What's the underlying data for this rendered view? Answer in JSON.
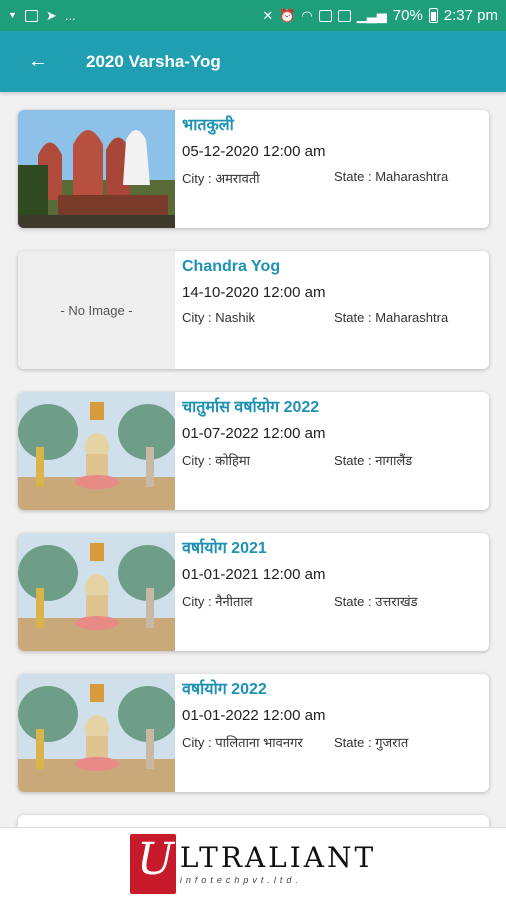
{
  "status_bar": {
    "left_icons": [
      "kb-icon",
      "image-icon",
      "telegram-icon",
      "more-icon"
    ],
    "more_text": "...",
    "battery": "70%",
    "time": "2:37 pm"
  },
  "app_bar": {
    "back_icon": "←",
    "title": "2020 Varsha-Yog"
  },
  "cards": [
    {
      "title": "भातकुली",
      "date": "05-12-2020 12:00 am",
      "city": "City : अमरावती",
      "state": "State : Maharashtra",
      "image": "temple"
    },
    {
      "title": "Chandra Yog",
      "date": "14-10-2020 12:00 am",
      "city": "City : Nashik",
      "state": "State : Maharashtra",
      "image": "none",
      "no_image_label": "- No Image -"
    },
    {
      "title": "चातुर्मास वर्षायोग 2022",
      "date": "01-07-2022 12:00 am",
      "city": "City : कोहिमा",
      "state": "State : नागालैंड",
      "image": "painting"
    },
    {
      "title": "वर्षायोग 2021",
      "date": "01-01-2021 12:00 am",
      "city": "City : नैनीताल",
      "state": "State : उत्तराखंड",
      "image": "painting"
    },
    {
      "title": "वर्षायोग 2022",
      "date": "01-01-2022 12:00 am",
      "city": "City : पालिताना भावनगर",
      "state": "State :  गुजरात",
      "image": "painting"
    }
  ],
  "footer": {
    "logo_mark": "U",
    "logo_word": "LTRALIANT",
    "logo_sub": "infotechpvt.ltd."
  }
}
